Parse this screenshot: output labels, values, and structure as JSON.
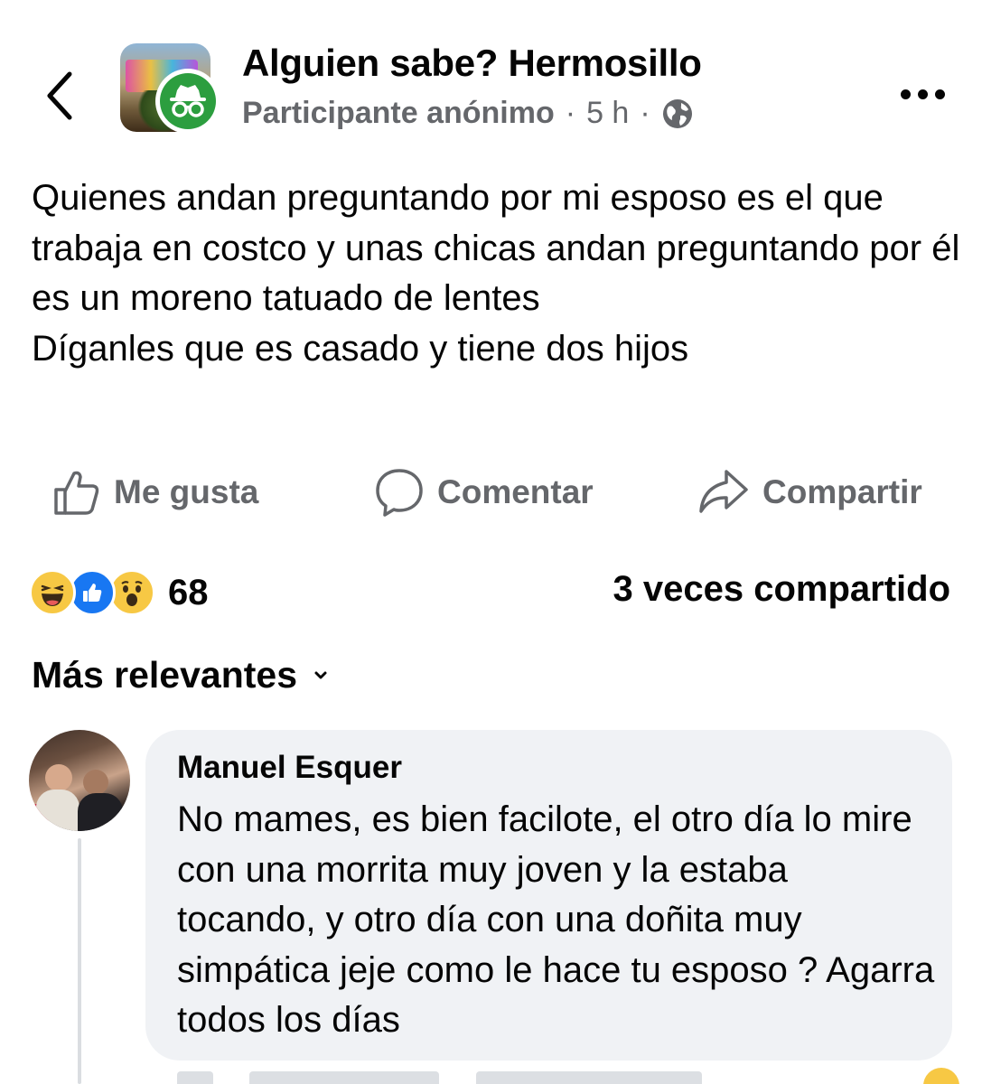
{
  "header": {
    "back_icon": "chevron-left-icon",
    "group_name": "Alguien sabe? Hermosillo",
    "author": "Participante anónimo",
    "separator": "·",
    "time": "5 h",
    "audience_icon": "globe-icon",
    "badge_icon": "anonymous-incognito-icon",
    "more_icon": "more-horizontal-icon"
  },
  "post": {
    "lines": [
      "Quienes andan preguntando por mi esposo es el que trabaja en costco y unas chicas andan preguntando por él es un moreno tatuado de lentes",
      "Díganles que es casado y tiene dos hijos"
    ]
  },
  "actions": {
    "like": "Me gusta",
    "comment": "Comentar",
    "share": "Compartir"
  },
  "stats": {
    "reaction_icons": [
      "haha-reaction",
      "like-reaction",
      "wow-reaction"
    ],
    "reaction_count": "68",
    "shares": "3 veces compartido"
  },
  "comments": {
    "sort_label": "Más relevantes",
    "items": [
      {
        "author": "Manuel Esquer",
        "text": "No mames, es bien facilote, el otro día lo mire con una morrita muy joven y la estaba tocando, y otro día con una doñita muy simpática jeje como le hace tu esposo ? Agarra todos los días"
      }
    ]
  },
  "colors": {
    "text_primary": "#050505",
    "text_secondary": "#65676b",
    "bubble_bg": "#f0f2f5",
    "like_blue": "#1877f2",
    "reaction_yellow": "#f7c844",
    "anon_badge_green": "#2c9e3f"
  }
}
